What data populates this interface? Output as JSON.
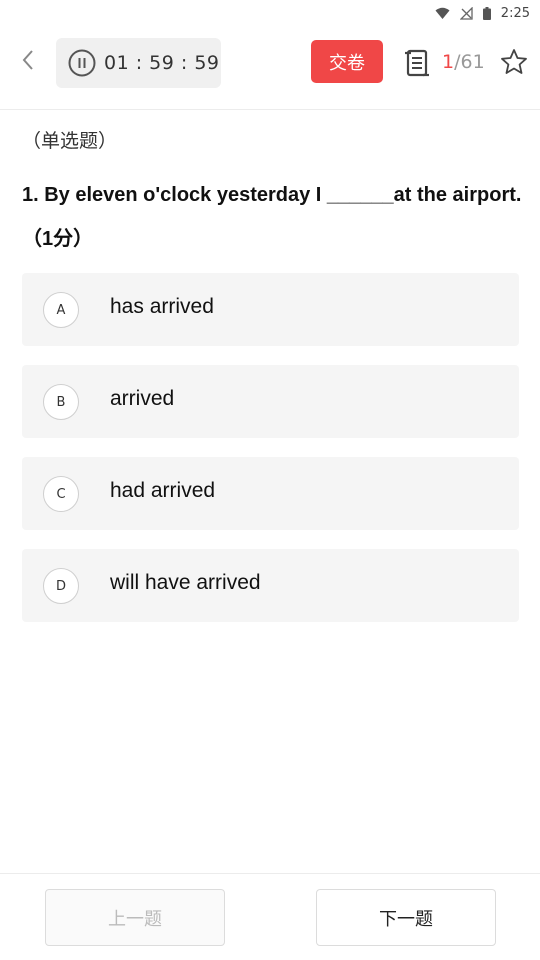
{
  "status_bar": {
    "time": "2:25",
    "icons": [
      "wifi-icon",
      "no-signal-icon",
      "battery-icon"
    ]
  },
  "header": {
    "back_icon": "chevron-left-icon",
    "timer_icon": "pause-icon",
    "timer": "01 : 59 : 59",
    "submit_label": "交卷",
    "answer_sheet_icon": "answer-sheet-icon",
    "progress_current": "1",
    "progress_total": "/61",
    "favorite_icon": "star-outline-icon"
  },
  "question": {
    "type": "（单选题）",
    "text": "1. By eleven o'clock yesterday I ______at the airport. （1分）"
  },
  "options": [
    {
      "letter": "A",
      "text": "has arrived"
    },
    {
      "letter": "B",
      "text": "arrived"
    },
    {
      "letter": "C",
      "text": "had arrived"
    },
    {
      "letter": "D",
      "text": "will have arrived"
    }
  ],
  "footer": {
    "prev_label": "上一题",
    "next_label": "下一题"
  },
  "colors": {
    "accent": "#f04747",
    "option_bg": "#f5f5f5",
    "timer_bg": "#f0f0f0"
  }
}
